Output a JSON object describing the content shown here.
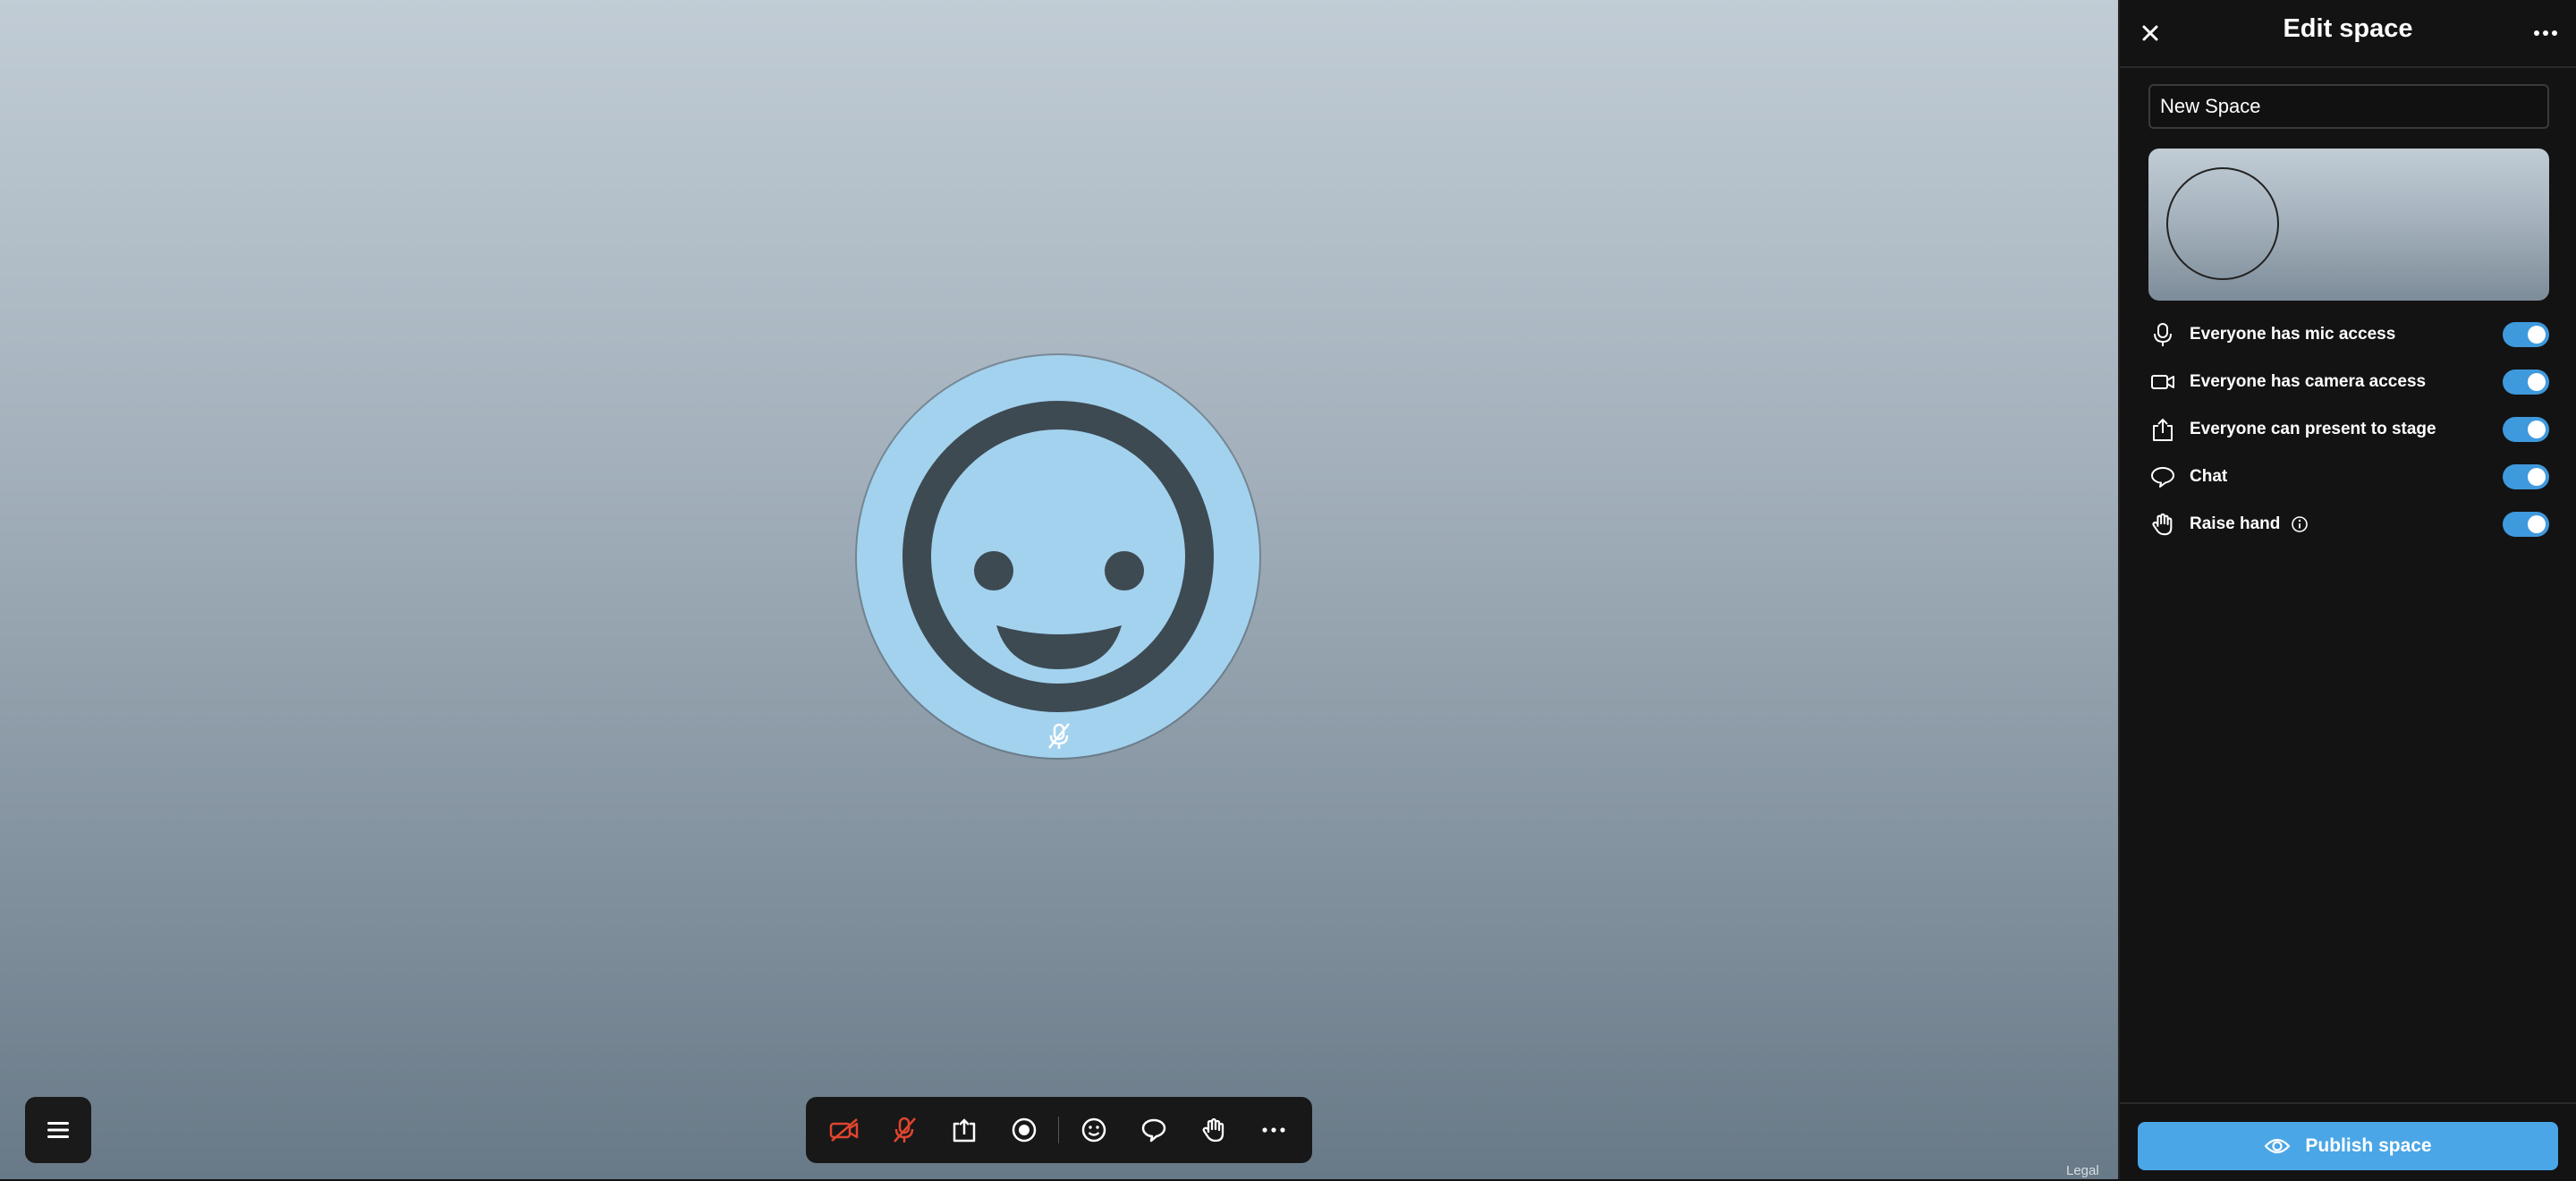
{
  "panel": {
    "title": "Edit space",
    "name_value": "New Space",
    "settings": [
      {
        "label": "Everyone has mic access",
        "icon": "mic-icon",
        "enabled": true
      },
      {
        "label": "Everyone has camera access",
        "icon": "camera-icon",
        "enabled": true
      },
      {
        "label": "Everyone can present to stage",
        "icon": "share-icon",
        "enabled": true
      },
      {
        "label": "Chat",
        "icon": "chat-icon",
        "enabled": true
      },
      {
        "label": "Raise hand",
        "icon": "hand-icon",
        "enabled": true
      }
    ],
    "publish_label": "Publish space"
  },
  "toolbar": {
    "items": [
      "camera-off-icon",
      "mic-off-icon",
      "share-screen-icon",
      "record-icon",
      "emoji-icon",
      "chat-icon",
      "raise-hand-icon",
      "more-icon"
    ]
  },
  "footer": {
    "legal": "Legal"
  },
  "colors": {
    "accent": "#4aa6e6",
    "toggle_on": "#3f99dd",
    "danger": "#e0452f",
    "avatar": "#a3d2ee",
    "face": "#3d4a52"
  }
}
